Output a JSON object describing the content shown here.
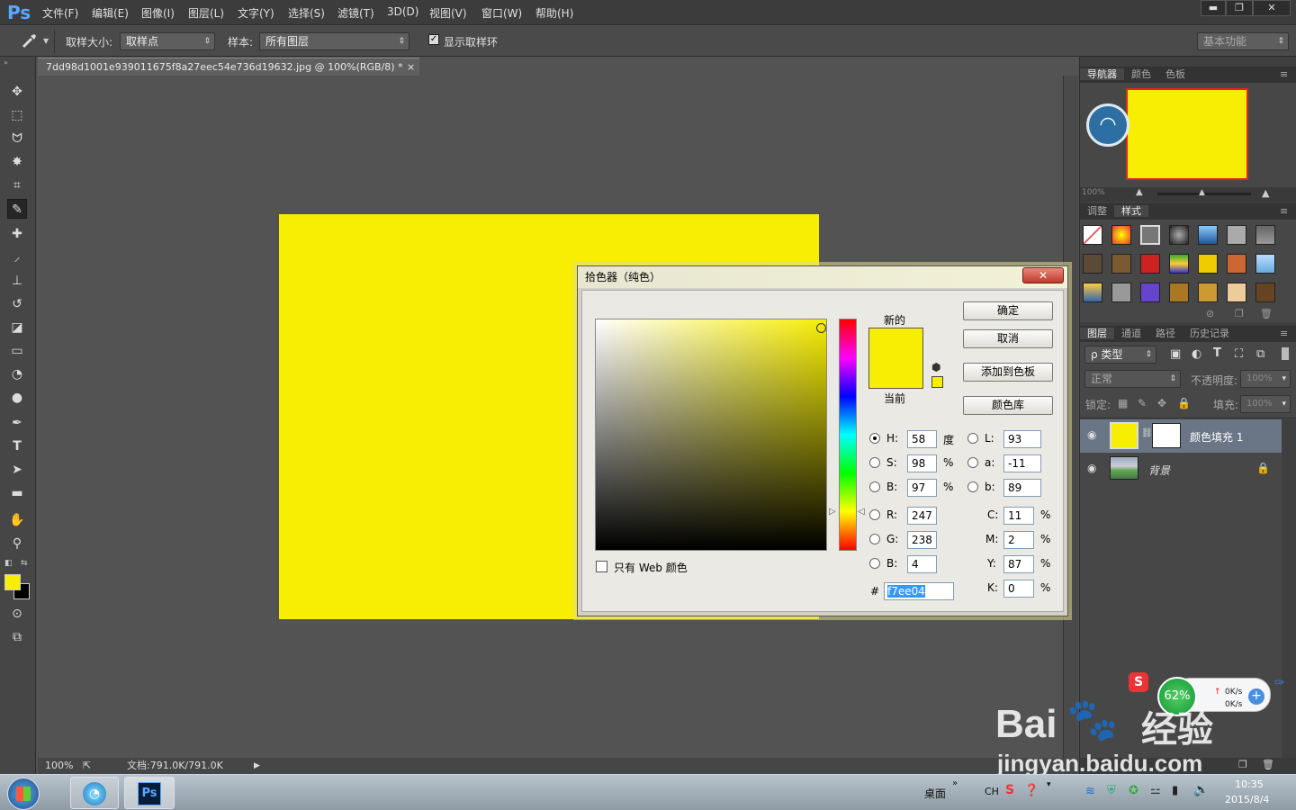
{
  "app": {
    "logo": "Ps",
    "menu": [
      "文件(F)",
      "编辑(E)",
      "图像(I)",
      "图层(L)",
      "文字(Y)",
      "选择(S)",
      "滤镜(T)",
      "3D(D)",
      "视图(V)",
      "窗口(W)",
      "帮助(H)"
    ]
  },
  "window": {
    "min": "▬",
    "max": "❐",
    "close": "✕"
  },
  "options": {
    "sample_size_label": "取样大小:",
    "sample_size_value": "取样点",
    "sample_label": "样本:",
    "sample_value": "所有图层",
    "show_ring_label": "显示取样环",
    "workspace": "基本功能"
  },
  "document": {
    "tab_title": "7dd98d1001e939011675f8a27eec54e736d19632.jpg @ 100%(RGB/8) *",
    "tab_close": "×",
    "zoom": "100%",
    "doc_size": "文档:791.0K/791.0K",
    "fill_color": "#f7ee04"
  },
  "navigator": {
    "tabs": [
      "导航器",
      "颜色",
      "色板"
    ],
    "zoom": "100%"
  },
  "styles": {
    "tabs": [
      "调整",
      "样式"
    ]
  },
  "layers": {
    "tabs": [
      "图层",
      "通道",
      "路径",
      "历史记录"
    ],
    "kind": "ρ 类型",
    "blend": "正常",
    "opacity_label": "不透明度:",
    "opacity": "100%",
    "lock_label": "锁定:",
    "fill_label": "填充:",
    "fill": "100%",
    "items": [
      {
        "name": "颜色填充 1"
      },
      {
        "name": "背景"
      }
    ]
  },
  "picker": {
    "title": "拾色器（纯色）",
    "close": "✕",
    "ok": "确定",
    "cancel": "取消",
    "add_swatch": "添加到色板",
    "color_lib": "颜色库",
    "new_label": "新的",
    "current_label": "当前",
    "web_only": "只有 Web 颜色",
    "hash": "#",
    "hex": "f7ee04",
    "color": "#f7ee04",
    "fields": {
      "H": {
        "label": "H:",
        "value": "58",
        "unit": "度"
      },
      "S": {
        "label": "S:",
        "value": "98",
        "unit": "%"
      },
      "Bv": {
        "label": "B:",
        "value": "97",
        "unit": "%"
      },
      "R": {
        "label": "R:",
        "value": "247"
      },
      "G": {
        "label": "G:",
        "value": "238"
      },
      "Bc": {
        "label": "B:",
        "value": "4"
      },
      "L": {
        "label": "L:",
        "value": "93"
      },
      "a": {
        "label": "a:",
        "value": "-11"
      },
      "b": {
        "label": "b:",
        "value": "89"
      },
      "C": {
        "label": "C:",
        "value": "11",
        "unit": "%"
      },
      "M": {
        "label": "M:",
        "value": "2",
        "unit": "%"
      },
      "Y": {
        "label": "Y:",
        "value": "87",
        "unit": "%"
      },
      "K": {
        "label": "K:",
        "value": "0",
        "unit": "%"
      }
    }
  },
  "net_widget": {
    "percent": "62%",
    "up": "0K/s",
    "down": "0K/s"
  },
  "watermark": {
    "line1": "Bai",
    "line2": "经验",
    "line3": "jingyan.baidu.com"
  },
  "taskbar": {
    "desktop": "桌面",
    "lang": "CH",
    "time": "10:35",
    "date": "2015/8/4",
    "ps_label": "Ps"
  }
}
